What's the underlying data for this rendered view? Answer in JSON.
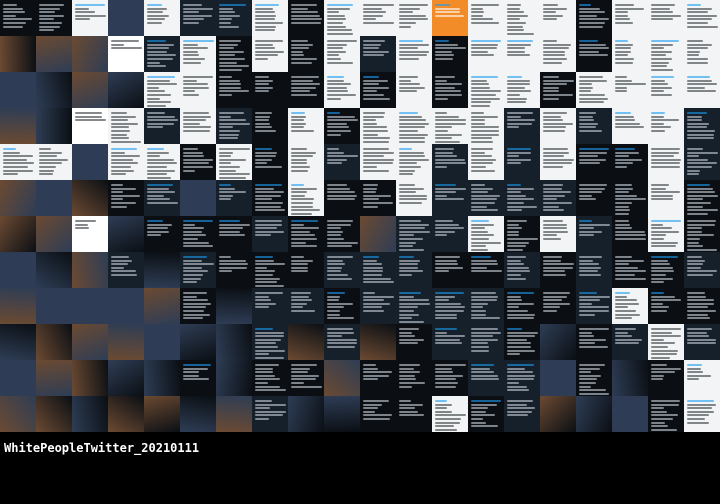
{
  "caption": "WhitePeopleTwitter_20210111",
  "grid": {
    "cols": 20,
    "rows": 12
  },
  "palette": {
    "dark_tweet": "#15202b",
    "darker": "#0b0f14",
    "light_tweet": "#f2f4f6",
    "white": "#ffffff",
    "photo_warm": "#6b4a32",
    "photo_cool": "#2e3d55",
    "accent_blue": "#1d9bf0",
    "accent_orange": "#f28c28",
    "text_light": "#c8d0d8",
    "text_dark": "#333a40"
  },
  "tiles": [
    "DDLPLDDLDLLLOLLLDLLL",
    "PPPWDLDLDLDLDLLLDLLL",
    "PPPPLLDDDLDLDLLDLLLL",
    "PPWLDLDDLDLLLLDLDLLD",
    "LLPLLDLDLDLLDLDLDDLD",
    "PPPDDPDDLDDLDDDDDDLD",
    "PPWPDDDDDDPDDLDLDDLD",
    "PPPDPDDDDDDDDDDDDDDD",
    "PPPPPDPDDDDDDDDDDLDD",
    "PPPPPPPDPDPDDDDPDDLD",
    "PPPPPDPDDPDDDDDPDPDL",
    "PPPPPPPDPPDDLDDPPPDL"
  ]
}
